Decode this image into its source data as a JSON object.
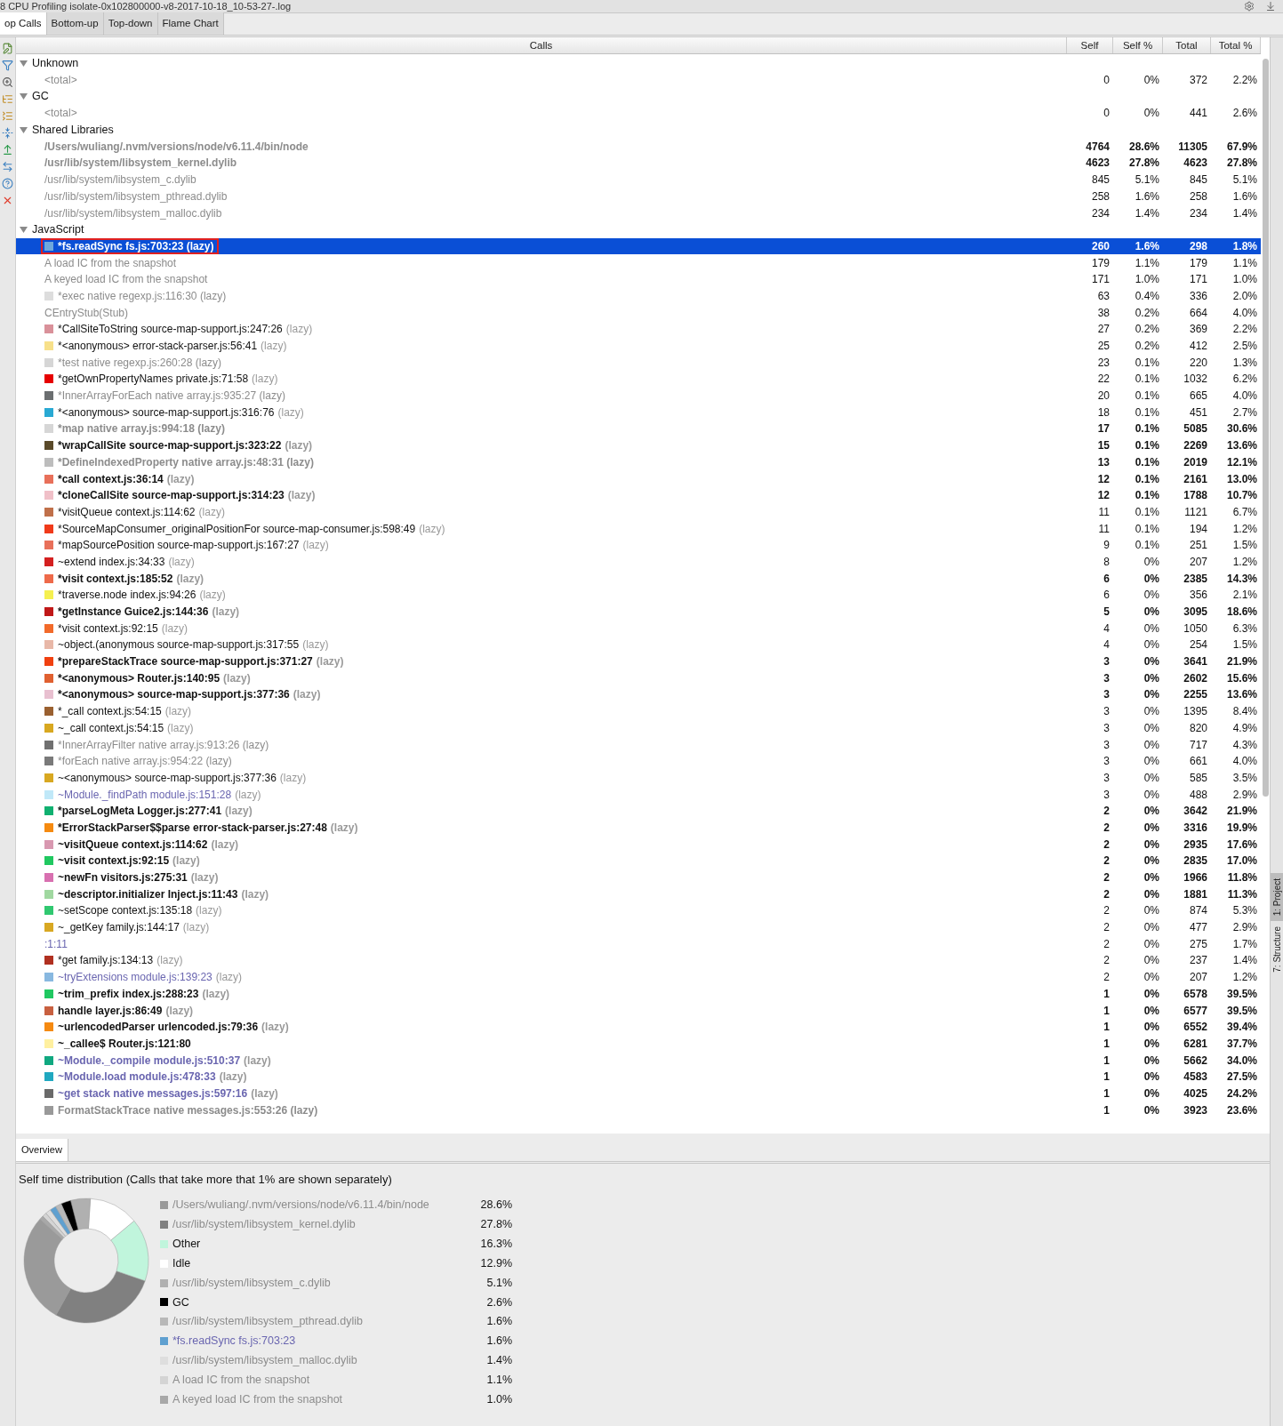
{
  "title_bar": {
    "title": "8 CPU Profiling isolate-0x102800000-v8-2017-10-18_10-53-27-.log"
  },
  "tabs": [
    {
      "label": "op Calls",
      "selected": true
    },
    {
      "label": "Bottom-up",
      "selected": false
    },
    {
      "label": "Top-down",
      "selected": false
    },
    {
      "label": "Flame Chart",
      "selected": false
    }
  ],
  "table": {
    "columns": [
      "Calls",
      "Self",
      "Self %",
      "Total",
      "Total %"
    ],
    "groups": [
      {
        "name": "Unknown",
        "expanded": true,
        "children": [
          {
            "name": "<total>",
            "kind": "grey",
            "bold": false,
            "selected": false,
            "self": "0",
            "self_pct": "0%",
            "total": "372",
            "total_pct": "2.2%"
          }
        ]
      },
      {
        "name": "GC",
        "expanded": true,
        "children": [
          {
            "name": "<total>",
            "kind": "grey",
            "bold": false,
            "selected": false,
            "self": "0",
            "self_pct": "0%",
            "total": "441",
            "total_pct": "2.6%"
          }
        ]
      },
      {
        "name": "Shared Libraries",
        "expanded": true,
        "children": [
          {
            "name": "/Users/wuliang/.nvm/versions/node/v6.11.4/bin/node",
            "kind": "grey",
            "bold": true,
            "selected": false,
            "self": "4764",
            "self_pct": "28.6%",
            "total": "11305",
            "total_pct": "67.9%"
          },
          {
            "name": "/usr/lib/system/libsystem_kernel.dylib",
            "kind": "grey",
            "bold": true,
            "selected": false,
            "self": "4623",
            "self_pct": "27.8%",
            "total": "4623",
            "total_pct": "27.8%"
          },
          {
            "name": "/usr/lib/system/libsystem_c.dylib",
            "kind": "grey",
            "bold": false,
            "selected": false,
            "self": "845",
            "self_pct": "5.1%",
            "total": "845",
            "total_pct": "5.1%"
          },
          {
            "name": "/usr/lib/system/libsystem_pthread.dylib",
            "kind": "grey",
            "bold": false,
            "selected": false,
            "self": "258",
            "self_pct": "1.6%",
            "total": "258",
            "total_pct": "1.6%"
          },
          {
            "name": "/usr/lib/system/libsystem_malloc.dylib",
            "kind": "grey",
            "bold": false,
            "selected": false,
            "self": "234",
            "self_pct": "1.4%",
            "total": "234",
            "total_pct": "1.4%"
          }
        ]
      },
      {
        "name": "JavaScript",
        "expanded": true,
        "children": [
          {
            "name": "*fs.readSync fs.js:703:23 (lazy)",
            "color": "#6fa8dc",
            "bold": true,
            "selected": true,
            "boxed": true,
            "self": "260",
            "self_pct": "1.6%",
            "total": "298",
            "total_pct": "1.8%"
          },
          {
            "name": "A load IC from the snapshot",
            "kind": "grey",
            "bold": false,
            "selected": false,
            "self": "179",
            "self_pct": "1.1%",
            "total": "179",
            "total_pct": "1.1%"
          },
          {
            "name": "A keyed load IC from the snapshot",
            "kind": "grey",
            "bold": false,
            "selected": false,
            "self": "171",
            "self_pct": "1.0%",
            "total": "171",
            "total_pct": "1.0%"
          },
          {
            "name": "*exec native regexp.js:116:30 (lazy)",
            "color": "#dddddd",
            "kind": "grey",
            "bold": false,
            "selected": false,
            "self": "63",
            "self_pct": "0.4%",
            "total": "336",
            "total_pct": "2.0%"
          },
          {
            "name": "CEntryStub(Stub)",
            "kind": "grey",
            "bold": false,
            "selected": false,
            "self": "38",
            "self_pct": "0.2%",
            "total": "664",
            "total_pct": "4.0%"
          },
          {
            "name": "*CallSiteToString source-map-support.js:247:26",
            "suffix": "(lazy)",
            "color": "#d9919a",
            "kind": "plain",
            "bold": false,
            "selected": false,
            "self": "27",
            "self_pct": "0.2%",
            "total": "369",
            "total_pct": "2.2%"
          },
          {
            "name": "*<anonymous> error-stack-parser.js:56:41",
            "suffix": "(lazy)",
            "color": "#f7e08a",
            "kind": "plain",
            "bold": false,
            "selected": false,
            "self": "25",
            "self_pct": "0.2%",
            "total": "412",
            "total_pct": "2.5%"
          },
          {
            "name": "*test native regexp.js:260:28 (lazy)",
            "color": "#d6d6d6",
            "kind": "grey",
            "bold": false,
            "selected": false,
            "self": "23",
            "self_pct": "0.1%",
            "total": "220",
            "total_pct": "1.3%"
          },
          {
            "name": "*getOwnPropertyNames private.js:71:58",
            "suffix": "(lazy)",
            "color": "#e60000",
            "kind": "plain",
            "bold": false,
            "selected": false,
            "self": "22",
            "self_pct": "0.1%",
            "total": "1032",
            "total_pct": "6.2%"
          },
          {
            "name": "*InnerArrayForEach native array.js:935:27 (lazy)",
            "color": "#6b6e70",
            "kind": "grey",
            "bold": false,
            "selected": false,
            "self": "20",
            "self_pct": "0.1%",
            "total": "665",
            "total_pct": "4.0%"
          },
          {
            "name": "*<anonymous> source-map-support.js:316:76",
            "suffix": "(lazy)",
            "color": "#29a9d3",
            "kind": "plain",
            "bold": false,
            "selected": false,
            "self": "18",
            "self_pct": "0.1%",
            "total": "451",
            "total_pct": "2.7%"
          },
          {
            "name": "*map native array.js:994:18 (lazy)",
            "color": "#d6d6d6",
            "kind": "grey",
            "bold": true,
            "selected": false,
            "self": "17",
            "self_pct": "0.1%",
            "total": "5085",
            "total_pct": "30.6%"
          },
          {
            "name": "*wrapCallSite source-map-support.js:323:22",
            "suffix": "(lazy)",
            "color": "#5a4a2a",
            "kind": "plain",
            "bold": true,
            "selected": false,
            "self": "15",
            "self_pct": "0.1%",
            "total": "2269",
            "total_pct": "13.6%"
          },
          {
            "name": "*DefineIndexedProperty native array.js:48:31 (lazy)",
            "color": "#bdbdbd",
            "kind": "grey",
            "bold": true,
            "selected": false,
            "self": "13",
            "self_pct": "0.1%",
            "total": "2019",
            "total_pct": "12.1%"
          },
          {
            "name": "*call context.js:36:14",
            "suffix": "(lazy)",
            "color": "#e8705a",
            "kind": "plain",
            "bold": true,
            "selected": false,
            "self": "12",
            "self_pct": "0.1%",
            "total": "2161",
            "total_pct": "13.0%"
          },
          {
            "name": "*cloneCallSite source-map-support.js:314:23",
            "suffix": "(lazy)",
            "color": "#f0c0c8",
            "kind": "plain",
            "bold": true,
            "selected": false,
            "self": "12",
            "self_pct": "0.1%",
            "total": "1788",
            "total_pct": "10.7%"
          },
          {
            "name": "*visitQueue context.js:114:62",
            "suffix": "(lazy)",
            "color": "#c0704a",
            "kind": "plain",
            "bold": false,
            "selected": false,
            "self": "11",
            "self_pct": "0.1%",
            "total": "1121",
            "total_pct": "6.7%"
          },
          {
            "name": "*SourceMapConsumer_originalPositionFor source-map-consumer.js:598:49",
            "suffix": "(lazy)",
            "color": "#f03a1a",
            "kind": "plain",
            "bold": false,
            "selected": false,
            "self": "11",
            "self_pct": "0.1%",
            "total": "194",
            "total_pct": "1.2%"
          },
          {
            "name": "*mapSourcePosition source-map-support.js:167:27",
            "suffix": "(lazy)",
            "color": "#e8705a",
            "kind": "plain",
            "bold": false,
            "selected": false,
            "self": "9",
            "self_pct": "0.1%",
            "total": "251",
            "total_pct": "1.5%"
          },
          {
            "name": "~extend index.js:34:33",
            "suffix": "(lazy)",
            "color": "#d42020",
            "kind": "plain",
            "bold": false,
            "selected": false,
            "self": "8",
            "self_pct": "0%",
            "total": "207",
            "total_pct": "1.2%"
          },
          {
            "name": "*visit context.js:185:52",
            "suffix": "(lazy)",
            "color": "#ee6a4a",
            "kind": "plain",
            "bold": true,
            "selected": false,
            "self": "6",
            "self_pct": "0%",
            "total": "2385",
            "total_pct": "14.3%"
          },
          {
            "name": "*traverse.node index.js:94:26",
            "suffix": "(lazy)",
            "color": "#f5f050",
            "kind": "plain",
            "bold": false,
            "selected": false,
            "self": "6",
            "self_pct": "0%",
            "total": "356",
            "total_pct": "2.1%"
          },
          {
            "name": "*getInstance Guice2.js:144:36",
            "suffix": "(lazy)",
            "color": "#c01818",
            "kind": "plain",
            "bold": true,
            "selected": false,
            "self": "5",
            "self_pct": "0%",
            "total": "3095",
            "total_pct": "18.6%"
          },
          {
            "name": "*visit context.js:92:15",
            "suffix": "(lazy)",
            "color": "#f26a2a",
            "kind": "plain",
            "bold": false,
            "selected": false,
            "self": "4",
            "self_pct": "0%",
            "total": "1050",
            "total_pct": "6.3%"
          },
          {
            "name": "~object.(anonymous source-map-support.js:317:55",
            "suffix": "(lazy)",
            "color": "#e8b8a8",
            "kind": "plain",
            "bold": false,
            "selected": false,
            "self": "4",
            "self_pct": "0%",
            "total": "254",
            "total_pct": "1.5%"
          },
          {
            "name": "*prepareStackTrace source-map-support.js:371:27",
            "suffix": "(lazy)",
            "color": "#f04010",
            "kind": "plain",
            "bold": true,
            "selected": false,
            "self": "3",
            "self_pct": "0%",
            "total": "3641",
            "total_pct": "21.9%"
          },
          {
            "name": "*<anonymous> Router.js:140:95",
            "suffix": "(lazy)",
            "color": "#e06030",
            "kind": "plain",
            "bold": true,
            "selected": false,
            "self": "3",
            "self_pct": "0%",
            "total": "2602",
            "total_pct": "15.6%"
          },
          {
            "name": "*<anonymous> source-map-support.js:377:36",
            "suffix": "(lazy)",
            "color": "#e8c0d0",
            "kind": "plain",
            "bold": true,
            "selected": false,
            "self": "3",
            "self_pct": "0%",
            "total": "2255",
            "total_pct": "13.6%"
          },
          {
            "name": "*_call context.js:54:15",
            "suffix": "(lazy)",
            "color": "#9a6030",
            "kind": "plain",
            "bold": false,
            "selected": false,
            "self": "3",
            "self_pct": "0%",
            "total": "1395",
            "total_pct": "8.4%"
          },
          {
            "name": "~_call context.js:54:15",
            "suffix": "(lazy)",
            "color": "#d8a820",
            "kind": "plain",
            "bold": false,
            "selected": false,
            "self": "3",
            "self_pct": "0%",
            "total": "820",
            "total_pct": "4.9%"
          },
          {
            "name": "*InnerArrayFilter native array.js:913:26 (lazy)",
            "color": "#707070",
            "kind": "grey",
            "bold": false,
            "selected": false,
            "self": "3",
            "self_pct": "0%",
            "total": "717",
            "total_pct": "4.3%"
          },
          {
            "name": "*forEach native array.js:954:22 (lazy)",
            "color": "#7a7a7a",
            "kind": "grey",
            "bold": false,
            "selected": false,
            "self": "3",
            "self_pct": "0%",
            "total": "661",
            "total_pct": "4.0%"
          },
          {
            "name": "~<anonymous> source-map-support.js:377:36",
            "suffix": "(lazy)",
            "color": "#d8a821",
            "kind": "plain",
            "bold": false,
            "selected": false,
            "self": "3",
            "self_pct": "0%",
            "total": "585",
            "total_pct": "3.5%"
          },
          {
            "name": "~Module._findPath module.js:151:28",
            "suffix": "(lazy)",
            "color": "#c0e8f8",
            "kind": "blue",
            "bold": false,
            "selected": false,
            "self": "3",
            "self_pct": "0%",
            "total": "488",
            "total_pct": "2.9%"
          },
          {
            "name": "*parseLogMeta Logger.js:277:41",
            "suffix": "(lazy)",
            "color": "#10b070",
            "kind": "plain",
            "bold": true,
            "selected": false,
            "self": "2",
            "self_pct": "0%",
            "total": "3642",
            "total_pct": "21.9%"
          },
          {
            "name": "*ErrorStackParser$$parse error-stack-parser.js:27:48",
            "suffix": "(lazy)",
            "color": "#f58a10",
            "kind": "plain",
            "bold": true,
            "selected": false,
            "self": "2",
            "self_pct": "0%",
            "total": "3316",
            "total_pct": "19.9%"
          },
          {
            "name": "~visitQueue context.js:114:62",
            "suffix": "(lazy)",
            "color": "#d898b0",
            "kind": "plain",
            "bold": true,
            "selected": false,
            "self": "2",
            "self_pct": "0%",
            "total": "2935",
            "total_pct": "17.6%"
          },
          {
            "name": "~visit context.js:92:15",
            "suffix": "(lazy)",
            "color": "#20c860",
            "kind": "plain",
            "bold": true,
            "selected": false,
            "self": "2",
            "self_pct": "0%",
            "total": "2835",
            "total_pct": "17.0%"
          },
          {
            "name": "~newFn visitors.js:275:31",
            "suffix": "(lazy)",
            "color": "#d870b0",
            "kind": "plain",
            "bold": true,
            "selected": false,
            "self": "2",
            "self_pct": "0%",
            "total": "1966",
            "total_pct": "11.8%"
          },
          {
            "name": "~descriptor.initializer Inject.js:11:43",
            "suffix": "(lazy)",
            "color": "#a0d8a0",
            "kind": "plain",
            "bold": true,
            "selected": false,
            "self": "2",
            "self_pct": "0%",
            "total": "1881",
            "total_pct": "11.3%"
          },
          {
            "name": "~setScope context.js:135:18",
            "suffix": "(lazy)",
            "color": "#30c870",
            "kind": "plain",
            "bold": false,
            "selected": false,
            "self": "2",
            "self_pct": "0%",
            "total": "874",
            "total_pct": "5.3%"
          },
          {
            "name": "~_getKey family.js:144:17",
            "suffix": "(lazy)",
            "color": "#d8a822",
            "kind": "plain",
            "bold": false,
            "selected": false,
            "self": "2",
            "self_pct": "0%",
            "total": "477",
            "total_pct": "2.9%"
          },
          {
            "name": ":1:11",
            "kind": "blue",
            "bold": false,
            "selected": false,
            "self": "2",
            "self_pct": "0%",
            "total": "275",
            "total_pct": "1.7%"
          },
          {
            "name": "*get family.js:134:13",
            "suffix": "(lazy)",
            "color": "#b03020",
            "kind": "plain",
            "bold": false,
            "selected": false,
            "self": "2",
            "self_pct": "0%",
            "total": "237",
            "total_pct": "1.4%"
          },
          {
            "name": "~tryExtensions module.js:139:23",
            "suffix": "(lazy)",
            "color": "#88b8e0",
            "kind": "blue",
            "bold": false,
            "selected": false,
            "self": "2",
            "self_pct": "0%",
            "total": "207",
            "total_pct": "1.2%"
          },
          {
            "name": "~trim_prefix index.js:288:23",
            "suffix": "(lazy)",
            "color": "#20c861",
            "kind": "plain",
            "bold": true,
            "selected": false,
            "self": "1",
            "self_pct": "0%",
            "total": "6578",
            "total_pct": "39.5%"
          },
          {
            "name": "handle layer.js:86:49",
            "suffix": "(lazy)",
            "color": "#c86040",
            "kind": "plain",
            "bold": true,
            "selected": false,
            "self": "1",
            "self_pct": "0%",
            "total": "6577",
            "total_pct": "39.5%"
          },
          {
            "name": "~urlencodedParser urlencoded.js:79:36",
            "suffix": "(lazy)",
            "color": "#f58a11",
            "kind": "plain",
            "bold": true,
            "selected": false,
            "self": "1",
            "self_pct": "0%",
            "total": "6552",
            "total_pct": "39.4%"
          },
          {
            "name": "~_callee$ Router.js:121:80",
            "color": "#fff0a0",
            "kind": "plain",
            "bold": true,
            "selected": false,
            "self": "1",
            "self_pct": "0%",
            "total": "6281",
            "total_pct": "37.7%"
          },
          {
            "name": "~Module._compile module.js:510:37",
            "suffix": "(lazy)",
            "color": "#10a880",
            "kind": "blue",
            "bold": true,
            "selected": false,
            "self": "1",
            "self_pct": "0%",
            "total": "5662",
            "total_pct": "34.0%"
          },
          {
            "name": "~Module.load module.js:478:33",
            "suffix": "(lazy)",
            "color": "#20a8c0",
            "kind": "blue",
            "bold": true,
            "selected": false,
            "self": "1",
            "self_pct": "0%",
            "total": "4583",
            "total_pct": "27.5%"
          },
          {
            "name": "~get stack native messages.js:597:16",
            "suffix": "(lazy)",
            "color": "#6a6a6a",
            "kind": "blue",
            "bold": true,
            "selected": false,
            "self": "1",
            "self_pct": "0%",
            "total": "4025",
            "total_pct": "24.2%"
          },
          {
            "name": "FormatStackTrace native messages.js:553:26 (lazy)",
            "color": "#999999",
            "kind": "grey",
            "bold": true,
            "selected": false,
            "self": "1",
            "self_pct": "0%",
            "total": "3923",
            "total_pct": "23.6%"
          }
        ]
      }
    ]
  },
  "overview": {
    "tabs": [
      {
        "label": "Overview",
        "selected": true
      }
    ],
    "heading": "Self time distribution (Calls that take more that 1% are shown separately)",
    "chart_data": {
      "type": "donut",
      "categories": [
        "/Users/wuliang/.nvm/versions/node/v6.11.4/bin/node",
        "/usr/lib/system/libsystem_kernel.dylib",
        "Other",
        "Idle",
        "/usr/lib/system/libsystem_c.dylib",
        "GC",
        "/usr/lib/system/libsystem_pthread.dylib",
        "*fs.readSync fs.js:703:23",
        "/usr/lib/system/libsystem_malloc.dylib",
        "A load IC from the snapshot",
        "A keyed load IC from the snapshot"
      ],
      "values": [
        28.6,
        27.8,
        16.3,
        12.9,
        5.1,
        2.6,
        1.6,
        1.6,
        1.4,
        1.1,
        1.0
      ]
    },
    "legend": [
      {
        "share": "28.6%",
        "color": "#9a9a9a",
        "kind": "grey"
      },
      {
        "share": "27.8%",
        "color": "#808080",
        "kind": "grey"
      },
      {
        "share": "16.3%",
        "color": "#c0f5dc",
        "kind": "plain"
      },
      {
        "share": "12.9%",
        "color": "#ffffff",
        "kind": "plain"
      },
      {
        "share": "5.1%",
        "color": "#b0b0b0",
        "kind": "grey"
      },
      {
        "share": "2.6%",
        "color": "#000000",
        "kind": "plain"
      },
      {
        "share": "1.6%",
        "color": "#b8b8b8",
        "kind": "grey"
      },
      {
        "share": "1.6%",
        "color": "#5fa0d0",
        "kind": "blue"
      },
      {
        "share": "1.4%",
        "color": "#dedede",
        "kind": "grey"
      },
      {
        "share": "1.1%",
        "color": "#d4d4d4",
        "kind": "grey"
      },
      {
        "share": "1.0%",
        "color": "#a8a8a8",
        "kind": "grey"
      }
    ]
  },
  "side_tabs": [
    {
      "label": "1: Project",
      "selected": true
    },
    {
      "label": "7: Structure",
      "selected": false
    }
  ]
}
